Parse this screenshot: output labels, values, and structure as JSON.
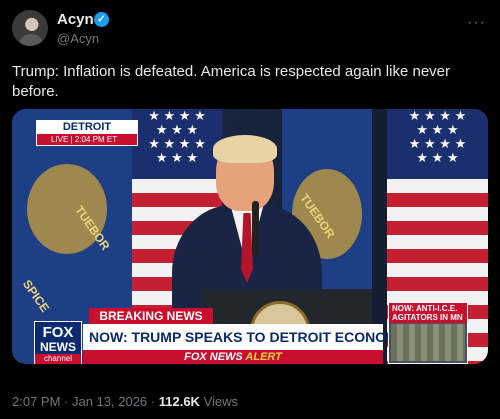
{
  "tweet": {
    "author_name": "Acyn",
    "author_handle": "@Acyn",
    "verified_badge": "✓",
    "more_menu": "···",
    "text": "Trump: Inflation is defeated. America is respected again like never before."
  },
  "video": {
    "location_label": "DETROIT",
    "live_time": "LIVE | 2:04 PM ET",
    "flag_text_1": "TUEBOR",
    "flag_text_2": "TUEBOR",
    "flag_text_3": "SPICE",
    "breaking_label": "BREAKING NEWS",
    "headline": "NOW: TRUMP SPEAKS TO DETROIT ECONOMIC CLUB",
    "alert_prefix": "FOX NEWS",
    "alert_suffix": "ALERT",
    "network_logo_line1": "FOX",
    "network_logo_line2": "NEWS",
    "network_logo_line3": "channel",
    "side_panel_title": "NOW: ANTI-I.C.E. AGITATORS IN MN"
  },
  "meta": {
    "time": "2:07 PM",
    "separator": " · ",
    "date": "Jan 13, 2026",
    "views_count": "112.6K",
    "views_label": "Views"
  }
}
